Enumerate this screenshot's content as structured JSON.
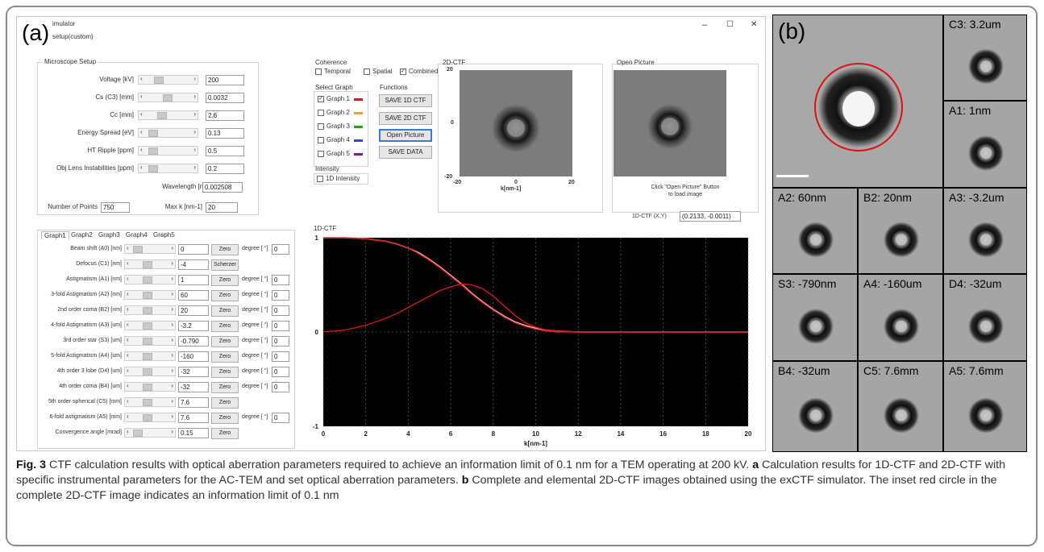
{
  "panel_a": {
    "tag": "(a)",
    "window": {
      "title": "imulator",
      "menu": "setup(custom)",
      "controls": [
        "–",
        "☐",
        "✕"
      ]
    },
    "microscope": {
      "title": "Microscope Setup",
      "rows": [
        {
          "label": "Voltage [kV]",
          "value": "200",
          "thumb": 0.2
        },
        {
          "label": "Cs (C3) [mm]",
          "value": "0.0032",
          "thumb": 0.45
        },
        {
          "label": "Cc [mm]",
          "value": "2.6",
          "thumb": 0.28
        },
        {
          "label": "Energy Spread [eV]",
          "value": "0.13",
          "thumb": 0.05
        },
        {
          "label": "HT Ripple [ppm]",
          "value": "0.5",
          "thumb": 0.05
        },
        {
          "label": "Obj Lens Instabilities [ppm]",
          "value": "0.2",
          "thumb": 0.05
        }
      ],
      "wavelength_label": "Wavelength [nm]",
      "wavelength_value": "0.002508",
      "points_label": "Number of Points",
      "points_value": "750",
      "maxk_label": "Max k [nm-1]",
      "maxk_value": "20"
    },
    "coherence": {
      "title": "Coherence",
      "temporal": "Temporal",
      "spatial": "Spatial",
      "combined": "Combined"
    },
    "select_graph": {
      "title": "Select Graph",
      "items": [
        {
          "label": "Graph 1",
          "color": "#d42020",
          "checked": true
        },
        {
          "label": "Graph 2",
          "color": "#f0a020",
          "checked": false
        },
        {
          "label": "Graph 3",
          "color": "#20a020",
          "checked": false
        },
        {
          "label": "Graph 4",
          "color": "#2050d0",
          "checked": false
        },
        {
          "label": "Graph 5",
          "color": "#7020a0",
          "checked": false
        }
      ]
    },
    "functions": {
      "title": "Functions",
      "save_1d": "SAVE 1D CTF",
      "save_2d": "SAVE 2D CTF",
      "open_picture": "Open Picture",
      "save_data": "SAVE DATA"
    },
    "intensity": {
      "title": "Intensity",
      "option": "1D Intensity"
    },
    "ctf2d": {
      "title": "2D-CTF",
      "y_top": "20",
      "y_mid": "0",
      "y_bot": "-20",
      "x_left": "-20",
      "x_mid": "0",
      "x_right": "20",
      "xlabel": "k[nm-1]"
    },
    "open_pic": {
      "title": "Open Picture",
      "hint1": "Click \"Open Picture\" Button",
      "hint2": "to load image"
    },
    "readout": {
      "label": "1D-CTF (X,Y)",
      "value": "(0.2133, -0.0011)"
    },
    "tabs": [
      "Graph1",
      "Graph2",
      "Graph3",
      "Graph4",
      "Graph5"
    ],
    "aberrations": [
      {
        "label": "Beam shift (A0) [nm]",
        "value": "0",
        "button": "Zero",
        "degree": "0",
        "thumb": 0.05
      },
      {
        "label": "Defocus (C1) [nm]",
        "value": "-4",
        "button": "Scherzer",
        "thumb": 0.35
      },
      {
        "label": "Astigmatism (A1) [nm]",
        "value": "1",
        "button": "Zero",
        "degree": "0",
        "thumb": 0.35
      },
      {
        "label": "3-fold Astigmatism (A2) [nm]",
        "value": "60",
        "button": "Zero",
        "degree": "0",
        "thumb": 0.35
      },
      {
        "label": "2nd order coma (B2) [nm]",
        "value": "20",
        "button": "Zero",
        "degree": "0",
        "thumb": 0.35
      },
      {
        "label": "4-fold Astigmatism (A3) [um]",
        "value": "-3.2",
        "button": "Zero",
        "degree": "0",
        "thumb": 0.35
      },
      {
        "label": "3rd order star (S3) [um]",
        "value": "-0.790",
        "button": "Zero",
        "degree": "0",
        "thumb": 0.35
      },
      {
        "label": "5-fold Astigmatism (A4) [um]",
        "value": "-160",
        "button": "Zero",
        "degree": "0",
        "thumb": 0.35
      },
      {
        "label": "4th order 3 lobe (D4) [um]",
        "value": "-32",
        "button": "Zero",
        "degree": "0",
        "thumb": 0.35
      },
      {
        "label": "4th order coma (B4) [um]",
        "value": "-32",
        "button": "Zero",
        "degree": "0",
        "thumb": 0.35
      },
      {
        "label": "5th order spherical (C5) [mm]",
        "value": "7.6",
        "button": "Zero",
        "thumb": 0.35
      },
      {
        "label": "6-fold astigmatism (A5) [mm]",
        "value": "7.6",
        "button": "Zero",
        "degree": "0",
        "thumb": 0.35
      },
      {
        "label": "Convergence angle [mrad]",
        "value": "0.15",
        "button": "Zero",
        "thumb": 0.05
      }
    ],
    "degree_label": "degree [ °]",
    "chart_data": {
      "type": "line",
      "title": "1D-CTF",
      "xlabel": "k[nm-1]",
      "xlim": [
        0,
        20
      ],
      "ylim": [
        -1,
        1
      ],
      "xticks": [
        0,
        2,
        4,
        6,
        8,
        10,
        12,
        14,
        16,
        18,
        20
      ],
      "yticks": [
        1,
        0,
        -1
      ],
      "colors": {
        "envelope": "#f0b0b0",
        "ctf": "#e01818",
        "background": "#000000"
      },
      "x": [
        0,
        1,
        2,
        3,
        3.5,
        4,
        4.5,
        5,
        5.5,
        6,
        6.5,
        7,
        7.5,
        8,
        8.5,
        9,
        9.5,
        10,
        10.5,
        11,
        12,
        14,
        16,
        18,
        20
      ],
      "series": [
        {
          "values": [
            1.0,
            1.0,
            0.99,
            0.96,
            0.93,
            0.89,
            0.84,
            0.77,
            0.69,
            0.6,
            0.51,
            0.41,
            0.32,
            0.24,
            0.17,
            0.11,
            0.07,
            0.04,
            0.02,
            0.01,
            0.0,
            0.0,
            0.0,
            0.0,
            0.0
          ]
        },
        {
          "values": [
            1.0,
            1.0,
            0.99,
            0.96,
            0.93,
            0.89,
            0.83,
            0.76,
            0.68,
            0.59,
            0.5,
            0.4,
            0.31,
            0.23,
            0.16,
            0.1,
            0.06,
            0.03,
            0.01,
            0.0,
            0.0,
            0.0,
            0.0,
            0.0,
            0.0
          ]
        },
        {
          "values": [
            0.0,
            0.02,
            0.07,
            0.15,
            0.2,
            0.26,
            0.32,
            0.38,
            0.44,
            0.48,
            0.51,
            0.5,
            0.46,
            0.38,
            0.28,
            0.18,
            0.1,
            0.05,
            0.02,
            0.01,
            0.0,
            0.0,
            0.0,
            0.0,
            0.0
          ]
        }
      ]
    }
  },
  "panel_b": {
    "tag": "(b)",
    "tiles": [
      {
        "label": "C3: 3.2um"
      },
      {
        "label": "A1: 1nm"
      },
      {
        "label": "A2: 60nm"
      },
      {
        "label": "B2: 20nm"
      },
      {
        "label": "A3: -3.2um"
      },
      {
        "label": "S3: -790nm"
      },
      {
        "label": "A4: -160um"
      },
      {
        "label": "D4: -32um"
      },
      {
        "label": "B4: -32um"
      },
      {
        "label": "C5: 7.6mm"
      },
      {
        "label": "A5: 7.6mm"
      }
    ]
  },
  "caption": {
    "fig": "Fig. 3",
    "text1": " CTF calculation results with optical aberration parameters required to achieve an information limit of 0.1 nm for a TEM operating at 200 kV. ",
    "a": "a",
    "text2": " Calculation results for 1D-CTF and 2D-CTF with specific instrumental parameters for the AC-TEM and set optical aberration parameters. ",
    "b": "b",
    "text3": " Complete and elemental 2D-CTF images obtained using the exCTF simulator. The inset red circle in the complete 2D-CTF image indicates an information limit of 0.1 nm"
  }
}
